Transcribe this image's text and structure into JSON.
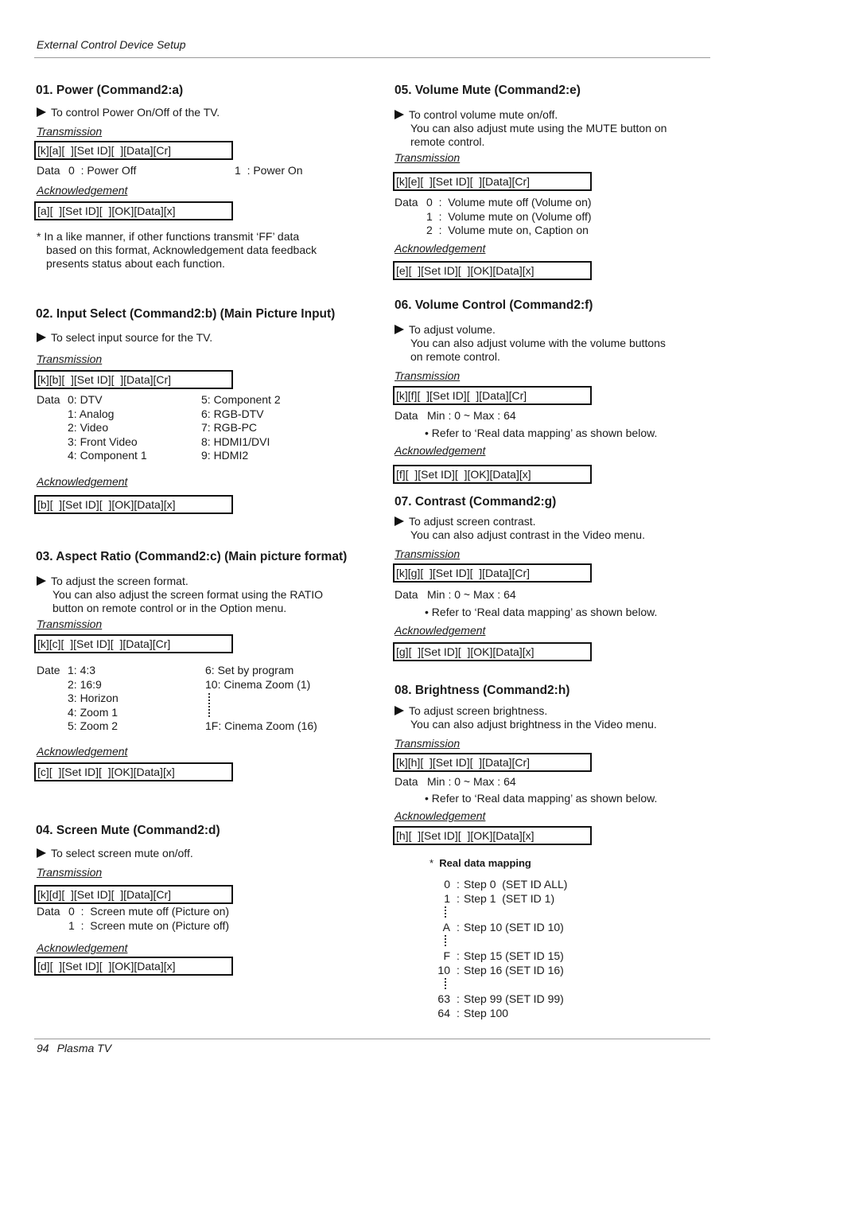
{
  "header": {
    "title": "External Control Device Setup"
  },
  "footer": {
    "page_number": "94",
    "product": "Plasma TV"
  },
  "labels": {
    "transmission": "Transmission",
    "acknowledgement": "Acknowledgement"
  },
  "sections": {
    "power": {
      "title": "01. Power (Command2:a)",
      "desc": [
        "To control Power On/Off of the TV."
      ],
      "transmission": "[k][a][  ][Set ID][  ][Data][Cr]",
      "data_prefix": "Data",
      "data": [
        "0  : Power Off",
        "1  : Power On"
      ],
      "acknowledgement": "[a][  ][Set ID][  ][OK][Data][x]",
      "note": [
        "* In a like manner, if other functions transmit ‘FF’ data",
        "based on this format, Acknowledgement data feedback",
        "presents status about each function."
      ]
    },
    "input_select": {
      "title": "02. Input Select (Command2:b) (Main Picture Input)",
      "desc": [
        "To select input source for the TV."
      ],
      "transmission": "[k][b][  ][Set ID][  ][Data][Cr]",
      "data_prefix": "Data",
      "data_left": [
        "0: DTV",
        "1: Analog",
        "2: Video",
        "3: Front Video",
        "4: Component 1"
      ],
      "data_right": [
        "5: Component 2",
        "6: RGB-DTV",
        "7: RGB-PC",
        "8: HDMI1/DVI",
        "9: HDMI2"
      ],
      "acknowledgement": "[b][  ][Set ID][  ][OK][Data][x]"
    },
    "aspect_ratio": {
      "title": "03. Aspect Ratio (Command2:c) (Main picture format)",
      "desc": [
        "To adjust the screen format.",
        "You can also adjust the screen format using the RATIO",
        "button on remote control or in the Option menu."
      ],
      "transmission": "[k][c][  ][Set ID][  ][Data][Cr]",
      "data_prefix": "Date",
      "data_left": [
        "1: 4:3",
        "2: 16:9",
        "3: Horizon",
        "4: Zoom 1",
        "5: Zoom 2"
      ],
      "data_right_top": [
        "6: Set by program",
        "10: Cinema Zoom (1)"
      ],
      "data_right_bottom": "1F: Cinema Zoom (16)",
      "acknowledgement": "[c][  ][Set ID][  ][OK][Data][x]"
    },
    "screen_mute": {
      "title": "04. Screen Mute (Command2:d)",
      "desc": [
        "To select screen mute on/off."
      ],
      "transmission": "[k][d][  ][Set ID][  ][Data][Cr]",
      "data_prefix": "Data",
      "data": [
        "0  :  Screen mute off (Picture on)",
        "1  :  Screen mute on (Picture off)"
      ],
      "acknowledgement": "[d][  ][Set ID][  ][OK][Data][x]"
    },
    "volume_mute": {
      "title": "05. Volume Mute (Command2:e)",
      "desc": [
        "To control volume mute on/off.",
        "You can also adjust mute using the MUTE button on",
        "remote control."
      ],
      "transmission": "[k][e][  ][Set ID][  ][Data][Cr]",
      "data_prefix": "Data",
      "data": [
        "0  :  Volume mute off (Volume on)",
        "1  :  Volume mute on (Volume off)",
        "2  :  Volume mute on, Caption on"
      ],
      "acknowledgement": "[e][  ][Set ID][  ][OK][Data][x]"
    },
    "volume_control": {
      "title": "06. Volume Control (Command2:f)",
      "desc": [
        "To adjust volume.",
        "You can also adjust volume with the volume buttons",
        "on remote control."
      ],
      "transmission": "[k][f][  ][Set ID][  ][Data][Cr]",
      "data_prefix": "Data",
      "data": "Min : 0 ~ Max : 64",
      "bullet": "Refer to ‘Real data mapping’ as shown below.",
      "acknowledgement": "[f][  ][Set ID][  ][OK][Data][x]"
    },
    "contrast": {
      "title": "07. Contrast (Command2:g)",
      "desc": [
        "To adjust screen contrast.",
        "You can also adjust contrast in the Video menu."
      ],
      "transmission": "[k][g][  ][Set ID][  ][Data][Cr]",
      "data_prefix": "Data",
      "data": "Min : 0 ~ Max : 64",
      "bullet": "Refer to ‘Real data mapping’ as shown below.",
      "acknowledgement": "[g][  ][Set ID][  ][OK][Data][x]"
    },
    "brightness": {
      "title": "08. Brightness (Command2:h)",
      "desc": [
        "To adjust screen brightness.",
        "You can also adjust brightness in the Video menu."
      ],
      "transmission": "[k][h][  ][Set ID][  ][Data][Cr]",
      "data_prefix": "Data",
      "data": "Min : 0 ~ Max : 64",
      "bullet": "Refer to ‘Real data mapping’ as shown below.",
      "acknowledgement": "[h][  ][Set ID][  ][OK][Data][x]"
    }
  },
  "real_data_mapping": {
    "title": "Real data mapping",
    "rows": [
      {
        "key": "0",
        "value": "Step 0  (SET ID ALL)"
      },
      {
        "key": "1",
        "value": "Step 1  (SET ID 1)"
      },
      {
        "key": "A",
        "value": "Step 10 (SET ID 10)"
      },
      {
        "key": "F",
        "value": "Step 15 (SET ID 15)"
      },
      {
        "key": "10",
        "value": "Step 16 (SET ID 16)"
      },
      {
        "key": "63",
        "value": "Step 99 (SET ID 99)"
      },
      {
        "key": "64",
        "value": "Step 100"
      }
    ]
  }
}
